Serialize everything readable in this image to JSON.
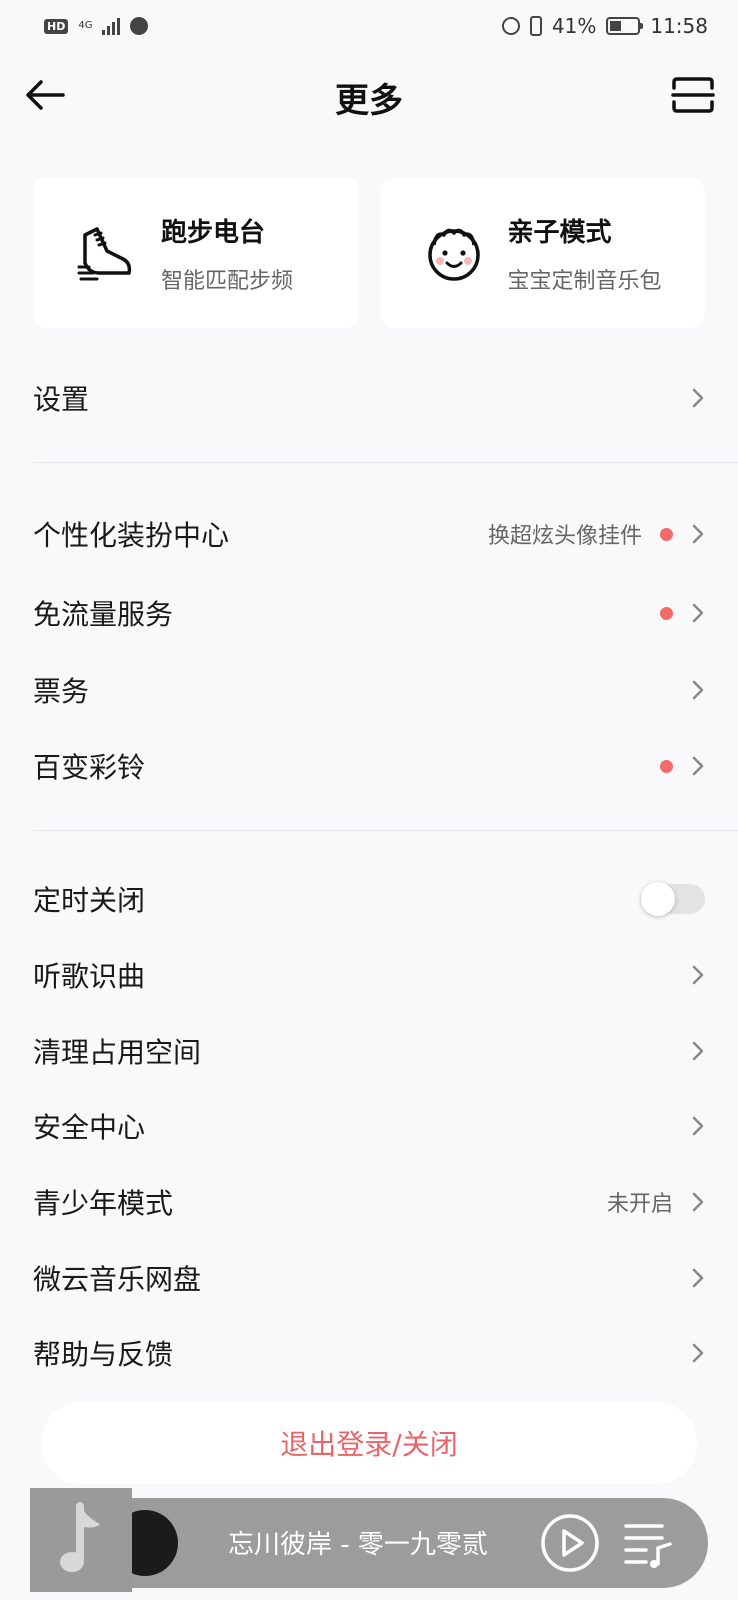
{
  "status_bar": {
    "hd": "HD",
    "network": "4G",
    "battery_percent": "41%",
    "time": "11:58",
    "battery_level": 0.41
  },
  "nav": {
    "title": "更多",
    "back_icon": "arrow-left-icon",
    "scan_icon": "scan-icon"
  },
  "cards": [
    {
      "title": "跑步电台",
      "subtitle": "智能匹配步频",
      "icon": "running-shoe-icon"
    },
    {
      "title": "亲子模式",
      "subtitle": "宝宝定制音乐包",
      "icon": "baby-face-icon"
    }
  ],
  "list": {
    "settings": "设置",
    "personalize": "个性化装扮中心",
    "personalize_extra": "换超炫头像挂件",
    "free_data": "免流量服务",
    "tickets": "票务",
    "ringtone": "百变彩铃",
    "timer_off": "定时关闭",
    "recognize": "听歌识曲",
    "clean": "清理占用空间",
    "security": "安全中心",
    "youth": "青少年模式",
    "youth_extra": "未开启",
    "cloud": "微云音乐网盘",
    "help": "帮助与反馈"
  },
  "timer_toggle_on": false,
  "logout_label": "退出登录/关闭",
  "player": {
    "song": "忘川彼岸 - 零一九零贰"
  },
  "colors": {
    "accent_red": "#f26b6b",
    "logout_text": "#e8666a",
    "background": "#f9f8fb"
  }
}
